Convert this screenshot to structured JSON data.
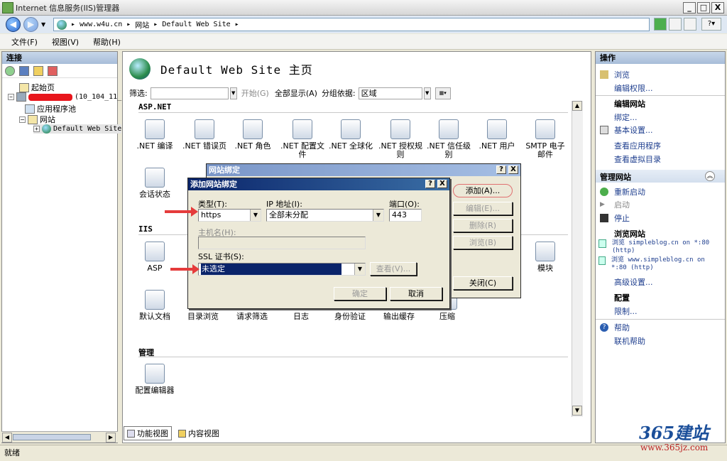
{
  "window": {
    "title": "Internet 信息服务(IIS)管理器",
    "min": "_",
    "max": "□",
    "close": "X"
  },
  "address": {
    "parts": [
      "www.w4u.cn",
      "网站",
      "Default Web Site"
    ],
    "sep": "▸"
  },
  "menu": {
    "file": "文件(F)",
    "view": "视图(V)",
    "help": "帮助(H)"
  },
  "connections": {
    "title": "连接",
    "start_page": "起始页",
    "server_suffix": "(10_104_11_",
    "app_pools": "应用程序池",
    "sites": "网站",
    "default_site": "Default Web Site"
  },
  "home": {
    "title": "Default Web Site 主页"
  },
  "filter": {
    "label": "筛选:",
    "start": "开始(G)",
    "show_all": "全部显示(A)",
    "group_by": "分组依据:",
    "group_value": "区域"
  },
  "sections": {
    "aspnet": "ASP.NET",
    "iis": "IIS",
    "manage": "管理"
  },
  "features_aspnet": [
    ".NET 编译",
    ".NET 错误页",
    ".NET 角色",
    ".NET 配置文件",
    ".NET 全球化",
    ".NET 授权规则",
    ".NET 信任级别",
    ".NET 用户",
    "SMTP 电子邮件"
  ],
  "features_row2": [
    "会话状态"
  ],
  "features_iis": [
    "ASP",
    "模块"
  ],
  "features_iis2": [
    "默认文档",
    "目录浏览",
    "请求筛选",
    "日志",
    "身份验证",
    "输出缓存",
    "压缩"
  ],
  "features_manage": [
    "配置编辑器"
  ],
  "actions": {
    "title": "操作",
    "browse": "浏览",
    "edit_perms": "编辑权限...",
    "edit_site": "编辑网站",
    "bindings": "绑定...",
    "basic_settings": "基本设置...",
    "view_apps": "查看应用程序",
    "view_vdirs": "查看虚拟目录",
    "manage_site": "管理网站",
    "restart": "重新启动",
    "start": "启动",
    "stop": "停止",
    "browse_site": "浏览网站",
    "browse1": "浏览 simpleblog.cn on *:80 (http)",
    "browse2": "浏览 www.simpleblog.cn on *:80 (http)",
    "advanced": "高级设置...",
    "config": "配置",
    "limits": "限制...",
    "help": "帮助",
    "online_help": "联机帮助"
  },
  "view_tabs": {
    "features": "功能视图",
    "content": "内容视图"
  },
  "status": "就绪",
  "bindings_dialog": {
    "title": "网站绑定",
    "help": "?",
    "close_x": "X",
    "add": "添加(A)...",
    "edit": "编辑(E)...",
    "remove": "删除(R)",
    "browse": "浏览(B)",
    "close": "关闭(C)"
  },
  "add_dialog": {
    "title": "添加网站绑定",
    "type_label": "类型(T):",
    "type_value": "https",
    "ip_label": "IP 地址(I):",
    "ip_value": "全部未分配",
    "port_label": "端口(O):",
    "port_value": "443",
    "host_label": "主机名(H):",
    "host_value": "",
    "ssl_label": "SSL 证书(S):",
    "ssl_value": "未选定",
    "view": "查看(V)...",
    "ok": "确定",
    "cancel": "取消"
  },
  "watermark": {
    "brand": "365建站",
    "url": "www.365jz.com"
  }
}
